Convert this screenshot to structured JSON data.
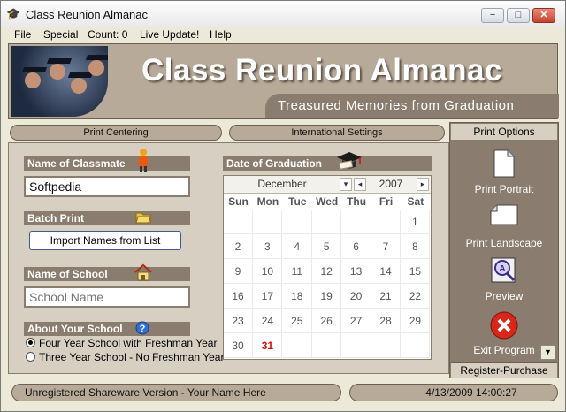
{
  "window": {
    "title": "Class Reunion Almanac"
  },
  "window_controls": {
    "minimize": "−",
    "maximize": "□",
    "close": "✕"
  },
  "menu": [
    {
      "label": "File"
    },
    {
      "label": "Special"
    },
    {
      "label": "Count: 0"
    },
    {
      "label": "Live Update!"
    },
    {
      "label": "Help"
    }
  ],
  "banner": {
    "title": "Class Reunion Almanac",
    "subtitle": "Treasured Memories from Graduation"
  },
  "tabs": {
    "print_centering": "Print Centering",
    "international_settings": "International Settings"
  },
  "classmate": {
    "label": "Name of Classmate",
    "value": "Softpedia"
  },
  "batch": {
    "label": "Batch Print",
    "import_button": "Import Names from List"
  },
  "school": {
    "label": "Name of School",
    "placeholder": "School Name"
  },
  "about": {
    "label": "About Your School",
    "options": [
      {
        "label": "Four Year School with Freshman Year",
        "selected": true
      },
      {
        "label": "Three Year School - No Freshman Year",
        "selected": false
      }
    ]
  },
  "graduation": {
    "label": "Date of Graduation",
    "month": "December",
    "year": "2007",
    "weekdays": [
      "Sun",
      "Mon",
      "Tue",
      "Wed",
      "Thu",
      "Fri",
      "Sat"
    ],
    "weeks": [
      [
        "",
        "",
        "",
        "",
        "",
        "",
        "1"
      ],
      [
        "2",
        "3",
        "4",
        "5",
        "6",
        "7",
        "8"
      ],
      [
        "9",
        "10",
        "11",
        "12",
        "13",
        "14",
        "15"
      ],
      [
        "16",
        "17",
        "18",
        "19",
        "20",
        "21",
        "22"
      ],
      [
        "23",
        "24",
        "25",
        "26",
        "27",
        "28",
        "29"
      ],
      [
        "30",
        "31",
        "",
        "",
        "",
        "",
        ""
      ]
    ],
    "highlight_day": "31",
    "highlight_color": "#d01010"
  },
  "print_options": {
    "header": "Print Options",
    "items": [
      {
        "label": "Print Portrait",
        "icon": "portrait-page-icon"
      },
      {
        "label": "Print Landscape",
        "icon": "landscape-page-icon"
      },
      {
        "label": "Preview",
        "icon": "preview-icon"
      },
      {
        "label": "Exit Program",
        "icon": "exit-icon"
      }
    ],
    "register": "Register-Purchase"
  },
  "status": {
    "left": "Unregistered Shareware Version - Your Name Here",
    "right": "4/13/2009 14:00:27"
  }
}
